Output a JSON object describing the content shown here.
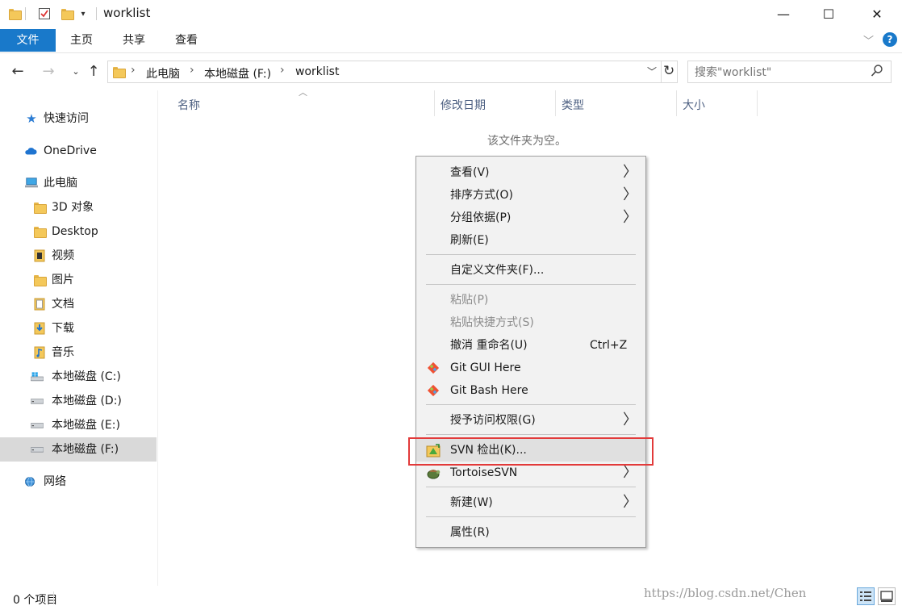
{
  "window": {
    "title": "worklist",
    "controls": {
      "minimize": "—",
      "maximize": "☐",
      "close": "✕"
    }
  },
  "ribbon": {
    "tabs": [
      "文件",
      "主页",
      "共享",
      "查看"
    ]
  },
  "address": {
    "crumbs": [
      "此电脑",
      "本地磁盘 (F:)",
      "worklist"
    ],
    "search_placeholder": "搜索\"worklist\""
  },
  "nav_pane": {
    "items": [
      {
        "label": "快速访问",
        "icon": "star-icon"
      },
      {
        "label": "OneDrive",
        "icon": "cloud-icon"
      },
      {
        "label": "此电脑",
        "icon": "computer-icon"
      },
      {
        "label": "3D 对象",
        "icon": "folder-3d-icon"
      },
      {
        "label": "Desktop",
        "icon": "desktop-folder-icon"
      },
      {
        "label": "视频",
        "icon": "video-folder-icon"
      },
      {
        "label": "图片",
        "icon": "pictures-folder-icon"
      },
      {
        "label": "文档",
        "icon": "documents-folder-icon"
      },
      {
        "label": "下载",
        "icon": "downloads-folder-icon"
      },
      {
        "label": "音乐",
        "icon": "music-folder-icon"
      },
      {
        "label": "本地磁盘 (C:)",
        "icon": "windows-drive-icon"
      },
      {
        "label": "本地磁盘 (D:)",
        "icon": "drive-icon"
      },
      {
        "label": "本地磁盘 (E:)",
        "icon": "drive-icon"
      },
      {
        "label": "本地磁盘 (F:)",
        "icon": "drive-icon",
        "selected": true
      },
      {
        "label": "网络",
        "icon": "network-icon"
      }
    ]
  },
  "content": {
    "columns": [
      "名称",
      "修改日期",
      "类型",
      "大小"
    ],
    "empty_message": "该文件夹为空。"
  },
  "context_menu": {
    "items": [
      {
        "label": "查看(V)",
        "submenu": true
      },
      {
        "label": "排序方式(O)",
        "submenu": true
      },
      {
        "label": "分组依据(P)",
        "submenu": true
      },
      {
        "label": "刷新(E)"
      },
      {
        "label": "自定义文件夹(F)..."
      },
      {
        "label": "粘贴(P)",
        "disabled": true
      },
      {
        "label": "粘贴快捷方式(S)",
        "disabled": true
      },
      {
        "label": "撤消 重命名(U)",
        "shortcut": "Ctrl+Z"
      },
      {
        "label": "Git GUI Here",
        "icon": "git-icon"
      },
      {
        "label": "Git Bash Here",
        "icon": "git-icon"
      },
      {
        "label": "授予访问权限(G)",
        "submenu": true
      },
      {
        "label": "SVN 检出(K)...",
        "icon": "svn-checkout-icon",
        "highlighted": true
      },
      {
        "label": "TortoiseSVN",
        "icon": "tortoisesvn-icon",
        "submenu": true
      },
      {
        "label": "新建(W)",
        "submenu": true
      },
      {
        "label": "属性(R)"
      }
    ],
    "arrow_glyph": "〉"
  },
  "status": {
    "item_count": "0 个项目",
    "watermark": "https://blog.csdn.net/Chen"
  },
  "colors": {
    "accent": "#1979ca",
    "highlight_box": "#e23a3a",
    "menu_bg": "#f2f2f2"
  }
}
